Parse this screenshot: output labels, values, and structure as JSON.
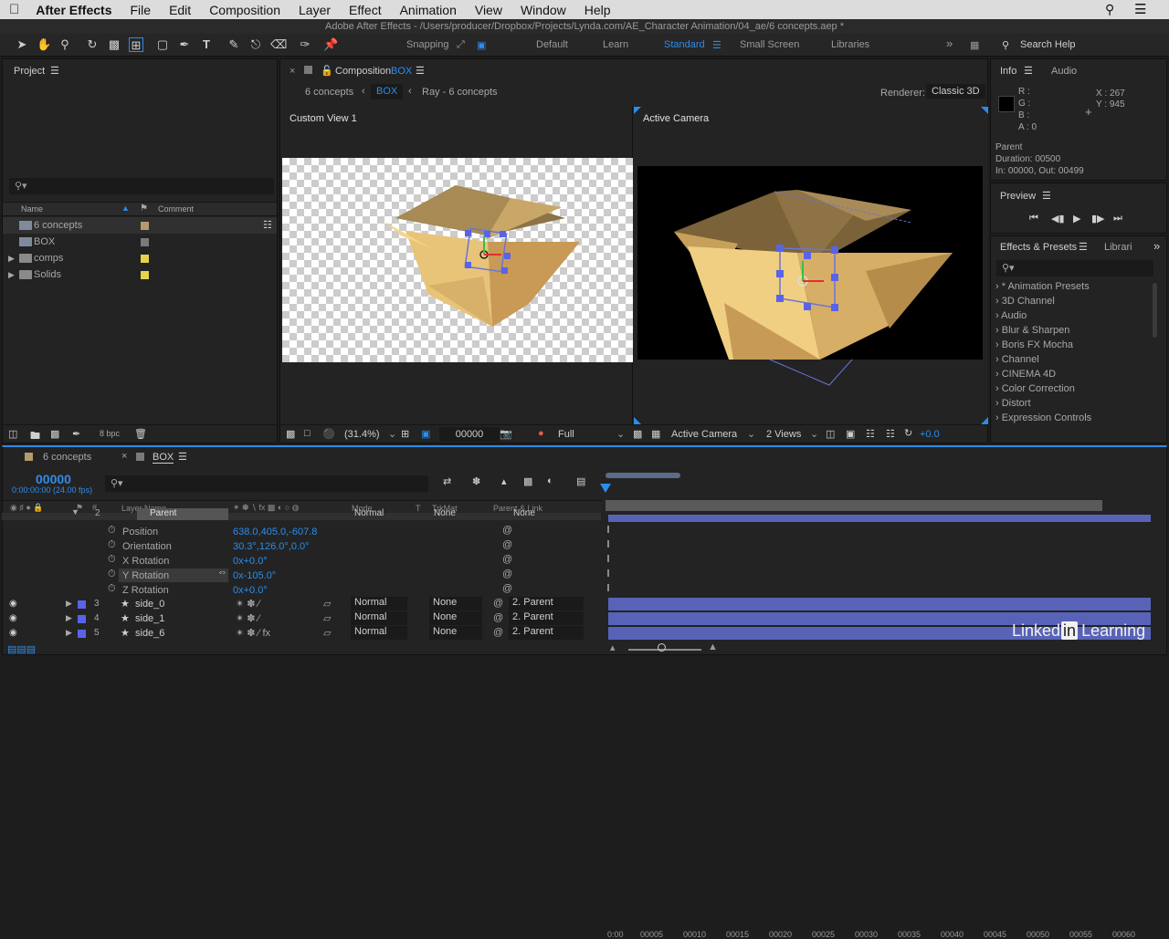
{
  "menu": {
    "apple": "",
    "app": "After Effects",
    "items": [
      "File",
      "Edit",
      "Composition",
      "Layer",
      "Effect",
      "Animation",
      "View",
      "Window",
      "Help"
    ]
  },
  "window_title": "Adobe After Effects - /Users/producer/Dropbox/Projects/Lynda.com/AE_Character Animation/04_ae/6 concepts.aep *",
  "toolbar": {
    "snapping": "Snapping",
    "workspaces": [
      "Default",
      "Learn",
      "Standard",
      "Small Screen",
      "Libraries"
    ],
    "search_help": "Search Help"
  },
  "project": {
    "title": "Project",
    "col_name": "Name",
    "col_comment": "Comment",
    "items": [
      {
        "name": "6 concepts",
        "color": "#b59a6c"
      },
      {
        "name": "BOX",
        "color": "#7a7a7a"
      },
      {
        "name": "comps",
        "color": "#e6d34b"
      },
      {
        "name": "Solids",
        "color": "#e6d34b"
      }
    ],
    "bpc": "8 bpc"
  },
  "composition": {
    "tab_prefix": "Composition",
    "tab_name": "BOX",
    "crumbs": [
      "6 concepts",
      "BOX",
      "Ray - 6 concepts"
    ],
    "renderer_label": "Renderer:",
    "renderer": "Classic 3D",
    "view_left": "Custom View 1",
    "view_right": "Active Camera",
    "footer": {
      "zoom": "(31.4%)",
      "time": "00000",
      "res": "Full",
      "camera": "Active Camera",
      "views": "2 Views",
      "exposure": "+0.0"
    }
  },
  "info": {
    "tab_info": "Info",
    "tab_audio": "Audio",
    "r": "R :",
    "g": "G :",
    "b": "B :",
    "a": "A :  0",
    "x": "X : 267",
    "y": "Y : 945",
    "layer": "Parent",
    "duration": "Duration: 00500",
    "inout": "In: 00000, Out: 00499"
  },
  "preview": {
    "title": "Preview"
  },
  "effects": {
    "title": "Effects & Presets",
    "tab2": "Librari",
    "items": [
      "* Animation Presets",
      "3D Channel",
      "Audio",
      "Blur & Sharpen",
      "Boris FX Mocha",
      "Channel",
      "CINEMA 4D",
      "Color Correction",
      "Distort",
      "Expression Controls"
    ]
  },
  "timeline": {
    "tab1": "6 concepts",
    "tab2": "BOX",
    "timecode": "00000",
    "fps": "0:00:00:00 (24.00 fps)",
    "col_layer": "Layer Name",
    "col_mode": "Mode",
    "col_t": "T",
    "col_trk": "TrkMat",
    "col_parent": "Parent & Link",
    "ticks": [
      "00005",
      "00010",
      "00015",
      "00020",
      "00025",
      "00030",
      "00035",
      "00040",
      "00045",
      "00050",
      "00055",
      "00060"
    ],
    "layers": [
      {
        "num": "2",
        "name": "Parent",
        "mode": "Normal",
        "trk": "None",
        "parent": "None"
      },
      {
        "num": "3",
        "name": "side_0",
        "mode": "Normal",
        "trk": "None",
        "parent": "2. Parent"
      },
      {
        "num": "4",
        "name": "side_1",
        "mode": "Normal",
        "trk": "None",
        "parent": "2. Parent"
      },
      {
        "num": "5",
        "name": "side_6",
        "mode": "Normal",
        "trk": "None",
        "parent": "2. Parent"
      }
    ],
    "props": [
      {
        "name": "Position",
        "value": "638.0,405.0,-607.8"
      },
      {
        "name": "Orientation",
        "value": "30.3°,126.0°,0.0°"
      },
      {
        "name": "X Rotation",
        "value": "0x+0.0°"
      },
      {
        "name": "Y Rotation",
        "value": "0x-105.0°"
      },
      {
        "name": "Z Rotation",
        "value": "0x+0.0°"
      }
    ]
  },
  "watermark": {
    "brand": "Linkedin Learning",
    "brand_a": "Linked",
    "brand_b": "in",
    "brand_c": "Learning"
  }
}
